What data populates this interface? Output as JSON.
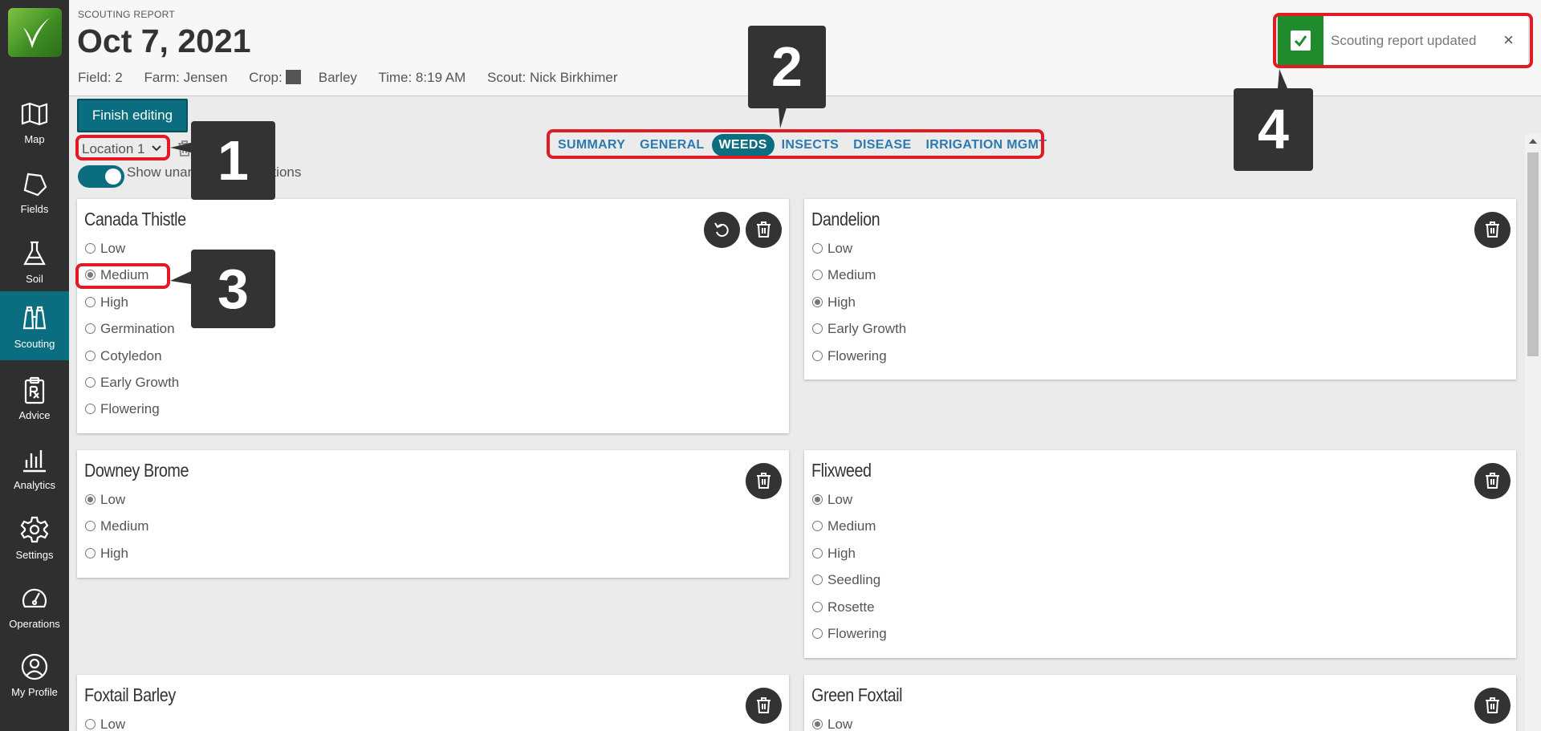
{
  "nav": [
    {
      "label": "Map",
      "icon": "map-icon"
    },
    {
      "label": "Fields",
      "icon": "fields-icon"
    },
    {
      "label": "Soil",
      "icon": "flask-icon"
    },
    {
      "label": "Scouting",
      "icon": "binoculars-icon",
      "active": true
    },
    {
      "label": "Advice",
      "icon": "clipboard-rx-icon"
    },
    {
      "label": "Analytics",
      "icon": "bar-chart-icon"
    },
    {
      "label": "Settings",
      "icon": "gear-icon"
    },
    {
      "label": "Operations",
      "icon": "gauge-icon"
    },
    {
      "label": "My Profile",
      "icon": "user-icon"
    }
  ],
  "header": {
    "kicker": "SCOUTING REPORT",
    "date": "Oct 7, 2021",
    "field": "Field: 2",
    "farm": "Farm: Jensen",
    "crop_label": "Crop:",
    "crop_value": "Barley",
    "time": "Time: 8:19 AM",
    "scout": "Scout: Nick Birkhimer"
  },
  "toolbar": {
    "finish_label": "Finish editing",
    "location": "Location 1",
    "toggle_label": "Show unanswered questions"
  },
  "tabs": [
    "SUMMARY",
    "GENERAL",
    "WEEDS",
    "INSECTS",
    "DISEASE",
    "IRRIGATION MGMT"
  ],
  "active_tab": "WEEDS",
  "cards": {
    "canada": {
      "title": "Canada Thistle",
      "options": [
        "Low",
        "Medium",
        "High",
        "Germination",
        "Cotyledon",
        "Early Growth",
        "Flowering"
      ],
      "selected": "Medium"
    },
    "dandelion": {
      "title": "Dandelion",
      "options": [
        "Low",
        "Medium",
        "High",
        "Early Growth",
        "Flowering"
      ],
      "selected": "High"
    },
    "downey": {
      "title": "Downey Brome",
      "options": [
        "Low",
        "Medium",
        "High"
      ],
      "selected": "Low"
    },
    "flixweed": {
      "title": "Flixweed",
      "options": [
        "Low",
        "Medium",
        "High",
        "Seedling",
        "Rosette",
        "Flowering"
      ],
      "selected": "Low"
    },
    "foxtail": {
      "title": "Foxtail Barley",
      "options": [
        "Low"
      ],
      "selected": ""
    },
    "green": {
      "title": "Green Foxtail",
      "options": [
        "Low"
      ],
      "selected": "Low"
    }
  },
  "toast": {
    "message": "Scouting report updated",
    "close": "×"
  },
  "callouts": [
    "1",
    "2",
    "3",
    "4"
  ],
  "colors": {
    "accent": "#0b6e80",
    "sidebar": "#2f2f2f",
    "success": "#1f8b2c",
    "highlight": "#e01b24",
    "tab_text": "#2b7bb0"
  }
}
